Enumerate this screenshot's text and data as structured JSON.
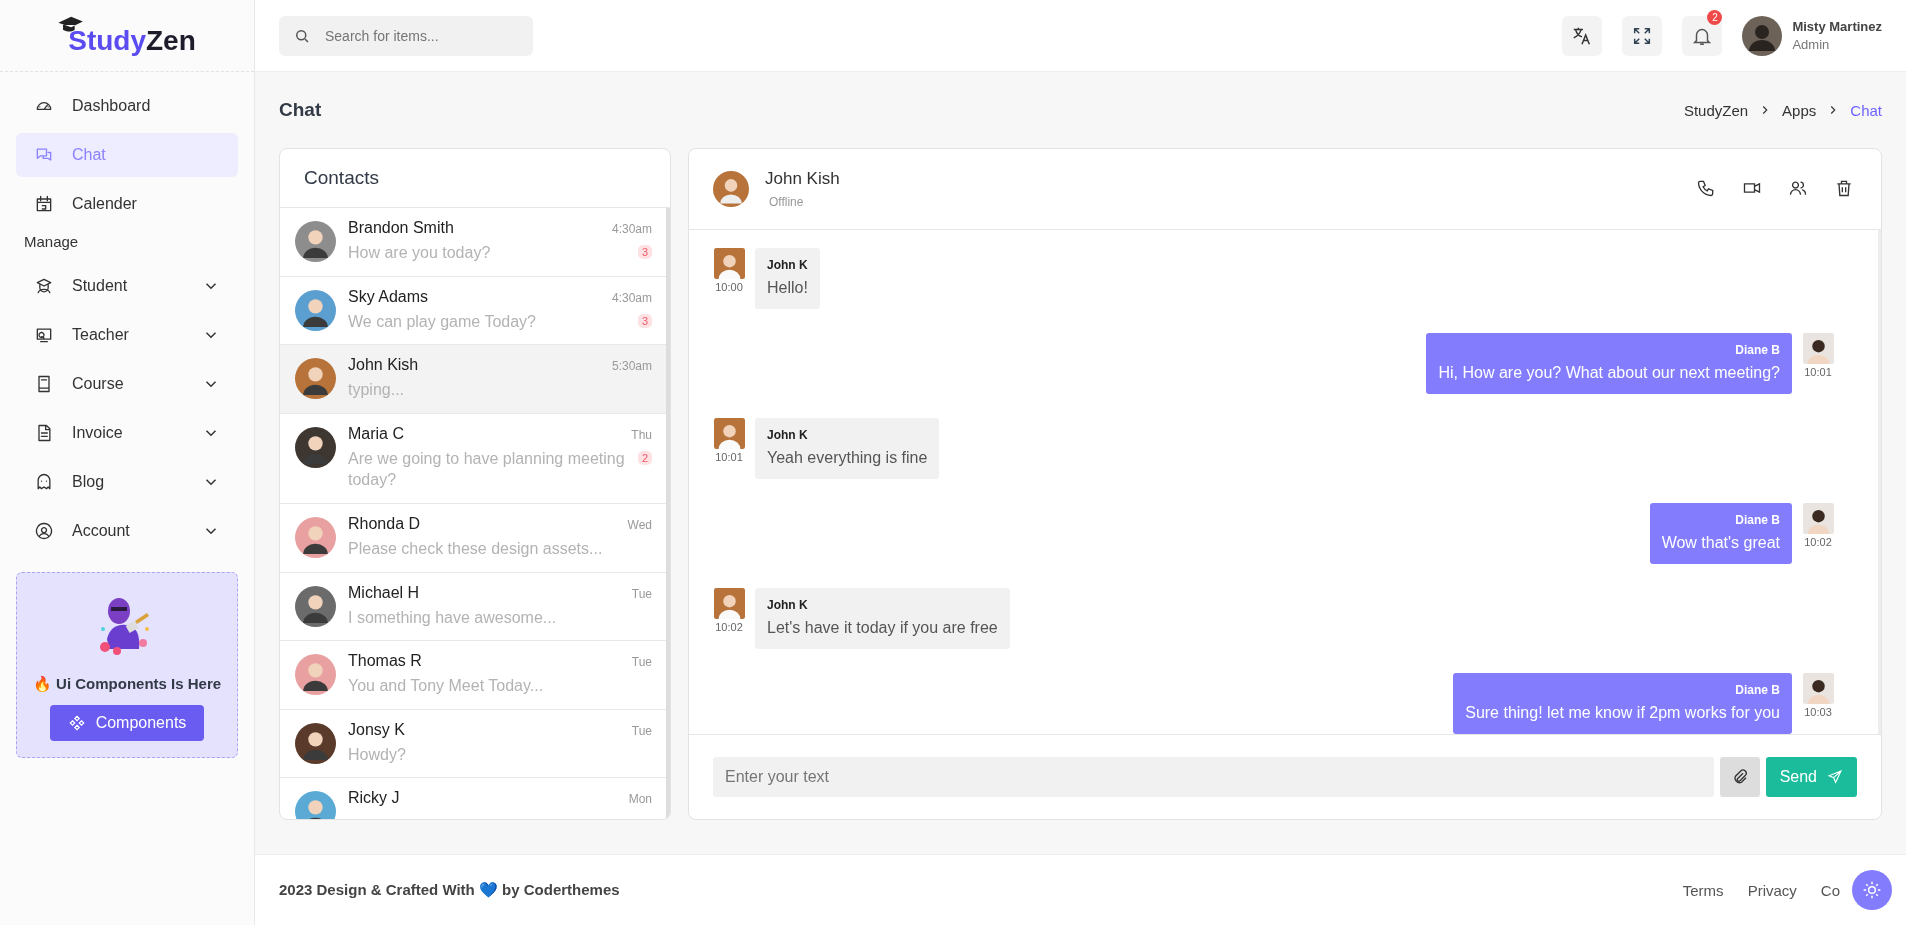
{
  "logo": {
    "part1": "Study",
    "part2": "Zen"
  },
  "search": {
    "placeholder": "Search for items..."
  },
  "topbar": {
    "notifications": "2",
    "user": {
      "name": "Misty Martinez",
      "role": "Admin"
    }
  },
  "sidebar": {
    "items": [
      {
        "label": "Dashboard",
        "selected": false,
        "expandable": false
      },
      {
        "label": "Chat",
        "selected": true,
        "expandable": false
      },
      {
        "label": "Calender",
        "selected": false,
        "expandable": false
      }
    ],
    "section": "Manage",
    "manage_items": [
      {
        "label": "Student",
        "selected": false,
        "expandable": true
      },
      {
        "label": "Teacher",
        "selected": false,
        "expandable": true
      },
      {
        "label": "Course",
        "selected": false,
        "expandable": true
      },
      {
        "label": "Invoice",
        "selected": false,
        "expandable": true
      },
      {
        "label": "Blog",
        "selected": false,
        "expandable": true
      },
      {
        "label": "Account",
        "selected": false,
        "expandable": true
      }
    ],
    "promo": {
      "title": "🔥 Ui Components Is Here",
      "button": "Components"
    }
  },
  "page": {
    "title": "Chat",
    "breadcrumb": [
      {
        "label": "StudyZen",
        "selected": false
      },
      {
        "label": "Apps",
        "selected": false
      },
      {
        "label": "Chat",
        "selected": true
      }
    ]
  },
  "contacts": {
    "title": "Contacts",
    "items": [
      {
        "name": "Brandon Smith",
        "message": "How are you today?",
        "time": "4:30am",
        "unread": "3",
        "selected": false
      },
      {
        "name": "Sky Adams",
        "message": "We can play game Today?",
        "time": "4:30am",
        "unread": "3",
        "selected": false
      },
      {
        "name": "John Kish",
        "message": "typing...",
        "time": "5:30am",
        "selected": true
      },
      {
        "name": "Maria C",
        "message": "Are we going to have planning meeting today?",
        "time": "Thu",
        "unread": "2",
        "selected": false
      },
      {
        "name": "Rhonda D",
        "message": "Please check these design assets...",
        "time": "Wed",
        "selected": false
      },
      {
        "name": "Michael H",
        "message": "I something have awesome...",
        "time": "Tue",
        "selected": false
      },
      {
        "name": "Thomas R",
        "message": "You and Tony Meet Today...",
        "time": "Tue",
        "selected": false
      },
      {
        "name": "Jonsy K",
        "message": "Howdy?",
        "time": "Tue",
        "selected": false
      },
      {
        "name": "Ricky J",
        "time": "Mon",
        "selected": false
      }
    ]
  },
  "chat": {
    "name": "John Kish",
    "status": "Offline",
    "messages": [
      {
        "kind": "incoming",
        "sender": "John K",
        "text": "Hello!",
        "time": "10:00"
      },
      {
        "kind": "outgoing",
        "sender": "Diane B",
        "text": "Hi, How are you? What about our next meeting?",
        "time": "10:01"
      },
      {
        "kind": "incoming",
        "sender": "John K",
        "text": "Yeah everything is fine",
        "time": "10:01"
      },
      {
        "kind": "outgoing",
        "sender": "Diane B",
        "text": "Wow that's great",
        "time": "10:02"
      },
      {
        "kind": "incoming",
        "sender": "John K",
        "text": "Let's have it today if you are free",
        "time": "10:02"
      },
      {
        "kind": "outgoing",
        "sender": "Diane B",
        "text": "Sure thing! let me know if 2pm works for you",
        "time": "10:03"
      }
    ],
    "input": {
      "placeholder": "Enter your text"
    },
    "send": "Send"
  },
  "footer": {
    "text": "2023 Design & Crafted With 💙 by Coderthemes",
    "links": [
      "Terms",
      "Privacy",
      "Co"
    ]
  }
}
